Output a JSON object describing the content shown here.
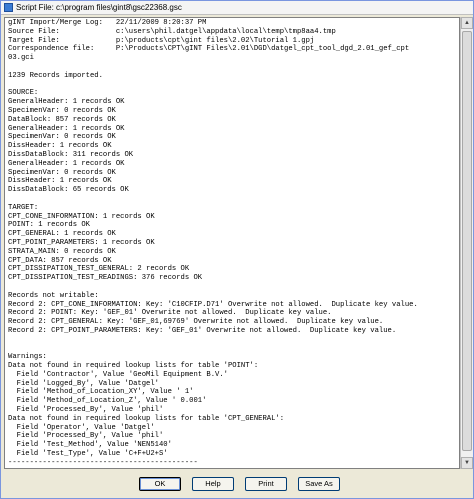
{
  "window": {
    "title": "Script File: c:\\program files\\gint8\\gsc22368.gsc"
  },
  "log_text": "gINT Import/Merge Log:   22/11/2009 8:20:37 PM\nSource File:             c:\\users\\phil.datgel\\appdata\\local\\temp\\tmp8aa4.tmp\nTarget File:             p:\\products\\cpt\\gint files\\2.02\\Tutorial 1.gpj\nCorrespondence file:     P:\\Products\\CPT\\gINT Files\\2.01\\DGD\\datgel_cpt_tool_dgd_2.01_gef_cpt\n03.gci\n\n1239 Records imported.\n\nSOURCE:\nGeneralHeader: 1 records OK\nSpecimenVar: 0 records OK\nDataBlock: 857 records OK\nGeneralHeader: 1 records OK\nSpecimenVar: 0 records OK\nDissHeader: 1 records OK\nDissDataBlock: 311 records OK\nGeneralHeader: 1 records OK\nSpecimenVar: 0 records OK\nDissHeader: 1 records OK\nDissDataBlock: 65 records OK\n\nTARGET:\nCPT_CONE_INFORMATION: 1 records OK\nPOINT: 1 records OK\nCPT_GENERAL: 1 records OK\nCPT_POINT_PARAMETERS: 1 records OK\nSTRATA_MAIN: 0 records OK\nCPT_DATA: 857 records OK\nCPT_DISSIPATION_TEST_GENERAL: 2 records OK\nCPT_DISSIPATION_TEST_READINGS: 376 records OK\n\nRecords not writable:\nRecord 2: CPT_CONE_INFORMATION: Key: 'C10CFIP.D71' Overwrite not allowed.  Duplicate key value.\nRecord 2: POINT: Key: 'GEF_01' Overwrite not allowed.  Duplicate key value.\nRecord 2: CPT_GENERAL: Key: 'GEF_01,69769' Overwrite not allowed.  Duplicate key value.\nRecord 2: CPT_POINT_PARAMETERS: Key: 'GEF_01' Overwrite not allowed.  Duplicate key value.\n\n\nWarnings:\nData not found in required lookup lists for table 'POINT':\n  Field 'Contractor', Value 'GeoMil Equipment B.V.'\n  Field 'Logged_By', Value 'Datgel'\n  Field 'Method_of_Location_XY', Value ' 1'\n  Field 'Method_of_Location_Z', Value ' 0.001'\n  Field 'Processed_By', Value 'phil'\nData not found in required lookup lists for table 'CPT_GENERAL':\n  Field 'Operator', Value 'Datgel'\n  Field 'Processed_By', Value 'phil'\n  Field 'Test_Method', Value 'NEN5140'\n  Field 'Test_Type', Value 'C+F+U2+S'\n--------------------------------------------",
  "buttons": {
    "ok": "OK",
    "help": "Help",
    "print": "Print",
    "save_as": "Save As"
  },
  "icons": {
    "app": "script-file-icon",
    "scroll_up": "arrow-up-icon",
    "scroll_down": "arrow-down-icon"
  }
}
